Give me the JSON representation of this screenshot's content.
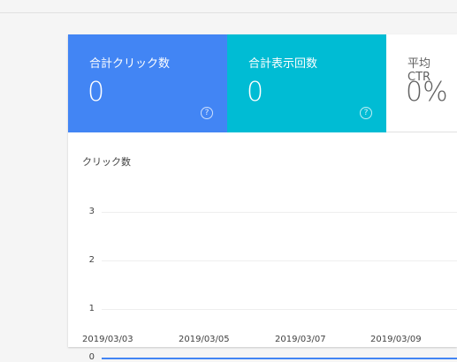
{
  "metrics": [
    {
      "label": "合計クリック数",
      "value": "0",
      "help_icon": "?",
      "color": "#4285f4"
    },
    {
      "label": "合計表示回数",
      "value": "0",
      "help_icon": "?",
      "color": "#00bcd4"
    },
    {
      "label": "平均 CTR",
      "value": "0%",
      "color": "#ffffff"
    }
  ],
  "chart_data": {
    "type": "line",
    "ylabel": "クリック数",
    "yticks": [
      "3",
      "2",
      "1",
      "0"
    ],
    "ylim": [
      0,
      3
    ],
    "x": [
      "2019/03/03",
      "2019/03/05",
      "2019/03/07",
      "2019/03/09"
    ],
    "series": [
      {
        "values": [
          0,
          0,
          0,
          0
        ]
      }
    ],
    "grid": true
  }
}
